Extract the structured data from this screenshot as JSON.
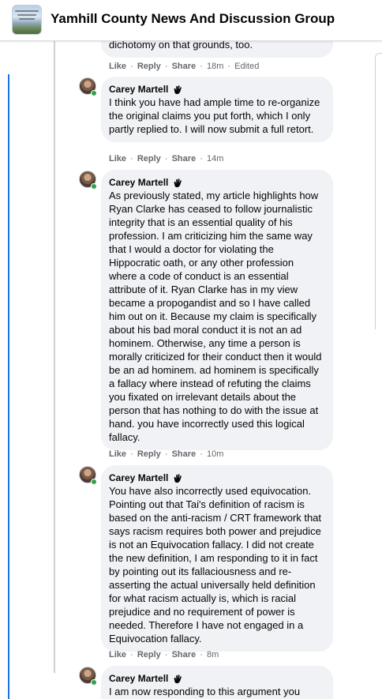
{
  "header": {
    "title": "Yamhill County News And Discussion Group"
  },
  "colors": {
    "accent": "#1b74e4",
    "bubble": "#f0f2f5",
    "meta": "#65676b",
    "presence": "#31a24c"
  },
  "actions": {
    "like": "Like",
    "reply": "Reply",
    "share": "Share",
    "dot": "·"
  },
  "first": {
    "text": "dichotomy on that grounds, too.",
    "meta": "18m",
    "edited": "Edited"
  },
  "comments": [
    {
      "author": "Carey Martell",
      "text": "I think you have had ample time to re-organize the original claims you put forth, which I only partly replied to. I will now submit a full retort.",
      "meta": "14m"
    },
    {
      "author": "Carey Martell",
      "text": "As previously stated, my article highlights how Ryan Clarke has ceased to follow journalistic integrity that is an essential quality of his profession. I am criticizing him the same way that I would a doctor for violating the Hippocratic oath, or any other profession where a code of conduct is an essential attribute of it. Ryan Clarke has in my view became a propogandist and so I have called him out on it. Because my claim is specifically about his bad moral conduct it is not an ad hominem. Otherwise, any time a person is morally criticized for their conduct then it would be an ad hominem. ad hominem is specifically a fallacy where instead of refuting the claims you fixated on irrelevant details about the person that has nothing to do with the issue at hand. you have incorrectly used this logical fallacy.",
      "meta": "10m"
    },
    {
      "author": "Carey Martell",
      "text": "You have also incorrectly used equivocation. Pointing out that Tai's definition of racism is based on the anti-racism / CRT framework that says racism requires both power and prejudice is not an Equivocation fallacy. I did not create the new definition, I am responding to it in fact by pointing out its fallaciousness and re-asserting the actual universally held definition for what racism actually is, which is racial prejudice and no requirement of power is needed. Therefore I have not engaged in a Equivocation fallacy.",
      "meta": "8m"
    },
    {
      "author": "Carey Martell",
      "text": "I am now responding to this argument you"
    }
  ]
}
